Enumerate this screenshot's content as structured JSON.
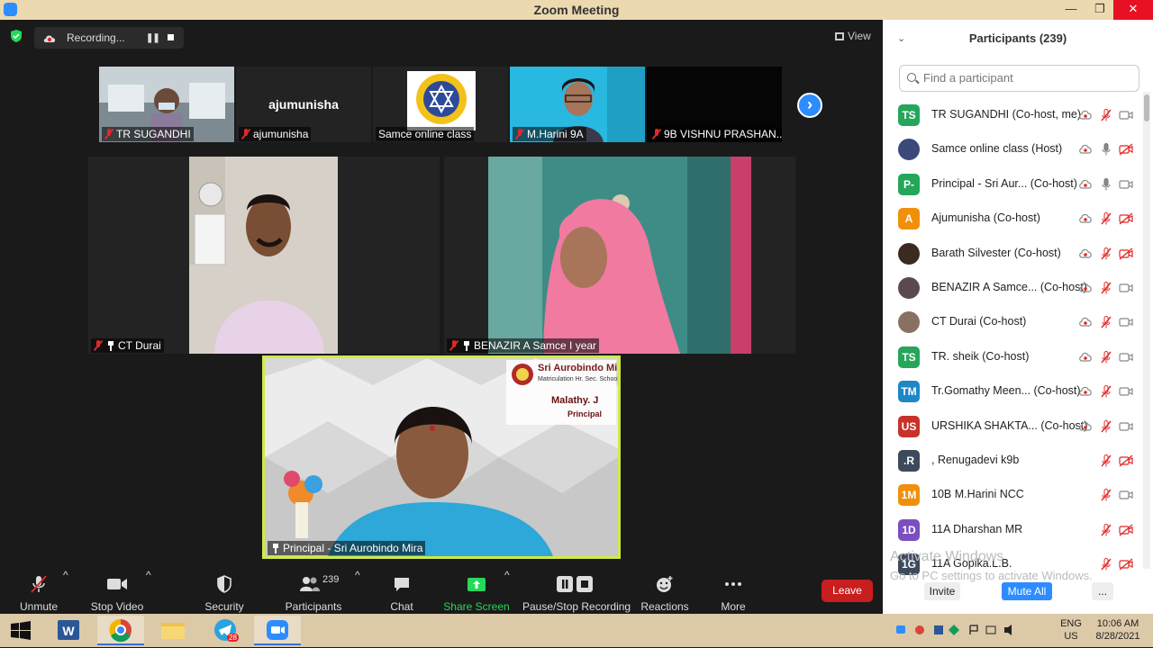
{
  "window": {
    "title": "Zoom Meeting",
    "minimize": "—",
    "restore": "❐",
    "close": "✕"
  },
  "top": {
    "recording_label": "Recording...",
    "view_label": "View"
  },
  "thumbnails": [
    {
      "name": "TR SUGANDHI"
    },
    {
      "name": "ajumunisha",
      "big_name": "ajumunisha"
    },
    {
      "name": "Samce online class"
    },
    {
      "name": "M.Harini 9A"
    },
    {
      "name": "9B VISHNU PRASHAN..."
    }
  ],
  "tiles": {
    "left": {
      "name": "CT Durai"
    },
    "right": {
      "name": "BENAZIR A Samce I year"
    },
    "main": {
      "name": "Principal - Sri Aurobindo Mira",
      "banner_title": "Sri Aurobindo Mira",
      "banner_sub": "Matriculation Hr. Sec. School",
      "person_name": "Malathy. J",
      "person_role": "Principal"
    }
  },
  "toolbar": {
    "unmute": "Unmute",
    "stop_video": "Stop Video",
    "security": "Security",
    "participants": "Participants",
    "participants_count": "239",
    "chat": "Chat",
    "share_screen": "Share Screen",
    "pause_stop": "Pause/Stop Recording",
    "reactions": "Reactions",
    "more": "More",
    "leave": "Leave"
  },
  "panel": {
    "title": "Participants (239)",
    "search_placeholder": "Find a participant",
    "participants": [
      {
        "initials": "TS",
        "color": "#25a65b",
        "name": "TR SUGANDHI (Co-host, me)",
        "mic": "muted",
        "video": "on",
        "rec": true
      },
      {
        "initials": "",
        "color": "#3b4a7a",
        "name": "Samce online class (Host)",
        "mic": "on",
        "video": "off",
        "rec": true
      },
      {
        "initials": "P-",
        "color": "#25a65b",
        "name": "Principal - Sri Aur...  (Co-host)",
        "mic": "on",
        "video": "on",
        "rec": true
      },
      {
        "initials": "A",
        "color": "#f0900a",
        "name": "Ajumunisha (Co-host)",
        "mic": "muted",
        "video": "off",
        "rec": true
      },
      {
        "initials": "",
        "color": "#3a2a20",
        "name": "Barath Silvester (Co-host)",
        "mic": "muted",
        "video": "off",
        "rec": true
      },
      {
        "initials": "",
        "color": "#5a4a50",
        "name": "BENAZIR A Samce...  (Co-host)",
        "mic": "muted",
        "video": "on",
        "rec": true
      },
      {
        "initials": "",
        "color": "#8a7060",
        "name": "CT Durai (Co-host)",
        "mic": "muted",
        "video": "on",
        "rec": true
      },
      {
        "initials": "TS",
        "color": "#25a65b",
        "name": "TR. sheik (Co-host)",
        "mic": "muted",
        "video": "on",
        "rec": true
      },
      {
        "initials": "TM",
        "color": "#1f86c8",
        "name": "Tr.Gomathy Meen...  (Co-host)",
        "mic": "muted",
        "video": "on",
        "rec": true
      },
      {
        "initials": "US",
        "color": "#c8322a",
        "name": "URSHIKA SHAKTA...  (Co-host)",
        "mic": "muted",
        "video": "on",
        "rec": true
      },
      {
        "initials": ".R",
        "color": "#3d4a5c",
        "name": ", Renugadevi k9b",
        "mic": "muted",
        "video": "off",
        "rec": false
      },
      {
        "initials": "1M",
        "color": "#f0900a",
        "name": "10B M.Harini NCC",
        "mic": "muted",
        "video": "on",
        "rec": false
      },
      {
        "initials": "1D",
        "color": "#7b4fbf",
        "name": "11A Dharshan MR",
        "mic": "muted",
        "video": "off",
        "rec": false
      },
      {
        "initials": "1G",
        "color": "#3d4a5c",
        "name": "11A Gopika.L.B.",
        "mic": "muted",
        "video": "off",
        "rec": false
      }
    ],
    "watermark_title": "Activate Windows",
    "watermark_sub": "Go to PC settings to activate Windows.",
    "invite": "Invite",
    "mute_all": "Mute All",
    "more": "..."
  },
  "taskbar": {
    "lang_top": "ENG",
    "lang_bottom": "US",
    "time": "10:06 AM",
    "date": "8/28/2021",
    "telegram_badge": "28"
  }
}
